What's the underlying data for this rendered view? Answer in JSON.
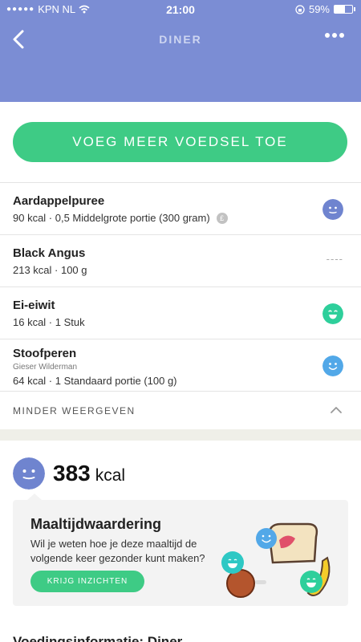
{
  "status": {
    "carrier": "KPN NL",
    "time": "21:00",
    "battery": "59%",
    "battery_level": 0.59
  },
  "nav": {
    "title": "DINER"
  },
  "add_button": "VOEG MEER VOEDSEL TOE",
  "items": [
    {
      "name": "Aardappelpuree",
      "detail": "90 kcal · 0,5 Middelgrote portie (300 gram)",
      "brand": "",
      "rating": "neutral",
      "rating_color": "#6f84cf",
      "badge": "£"
    },
    {
      "name": "Black Angus",
      "detail": "213 kcal · 100 g",
      "brand": "",
      "rating": "none",
      "dashes": "----"
    },
    {
      "name": "Ei-eiwit",
      "detail": "16 kcal · 1 Stuk",
      "brand": "",
      "rating": "happy",
      "rating_color": "#2ecf9b"
    },
    {
      "name": "Stoofperen",
      "detail": "64 kcal · 1 Standaard portie (100 g)",
      "brand": "Gieser Wilderman",
      "rating": "smile",
      "rating_color": "#52a8e8"
    }
  ],
  "show_less": "MINDER WEERGEVEN",
  "summary": {
    "kcal_value": "383",
    "kcal_unit": "kcal"
  },
  "card": {
    "title": "Maaltijdwaardering",
    "text": "Wil je weten hoe je deze maaltijd de volgende keer gezonder kunt maken?",
    "cta": "KRIJG INZICHTEN"
  },
  "footer_title": "Voedingsinformatie: Diner",
  "colors": {
    "header": "#7b8dd4",
    "accent_green": "#3ecb85",
    "neutral_face": "#6f84cf",
    "happy_face": "#2ecf9b",
    "smile_face": "#52a8e8"
  }
}
